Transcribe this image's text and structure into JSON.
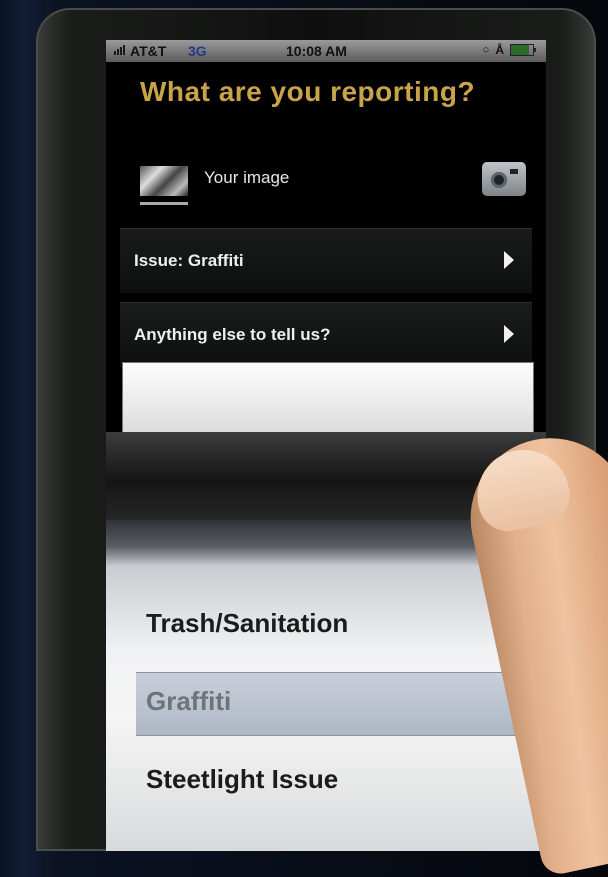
{
  "status_bar": {
    "carrier": "AT&T",
    "network": "3G",
    "time": "10:08 AM"
  },
  "screen": {
    "title": "What are you reporting?",
    "image_row": {
      "label": "Your image",
      "camera_icon": "camera-icon"
    },
    "rows": [
      {
        "label": "Issue: Graffiti",
        "icon": "chevron-right-icon"
      },
      {
        "label": "Anything else to tell us?",
        "icon": "chevron-right-icon"
      }
    ],
    "note_field": {
      "value": ""
    }
  },
  "picker": {
    "options": [
      "Trash/Sanitation",
      "Graffiti",
      "Steetlight Issue"
    ],
    "selected": "Graffiti"
  },
  "colors": {
    "title": "#c9a34a",
    "row_background": "#111111",
    "picker_selection": "#7d8ca3"
  }
}
